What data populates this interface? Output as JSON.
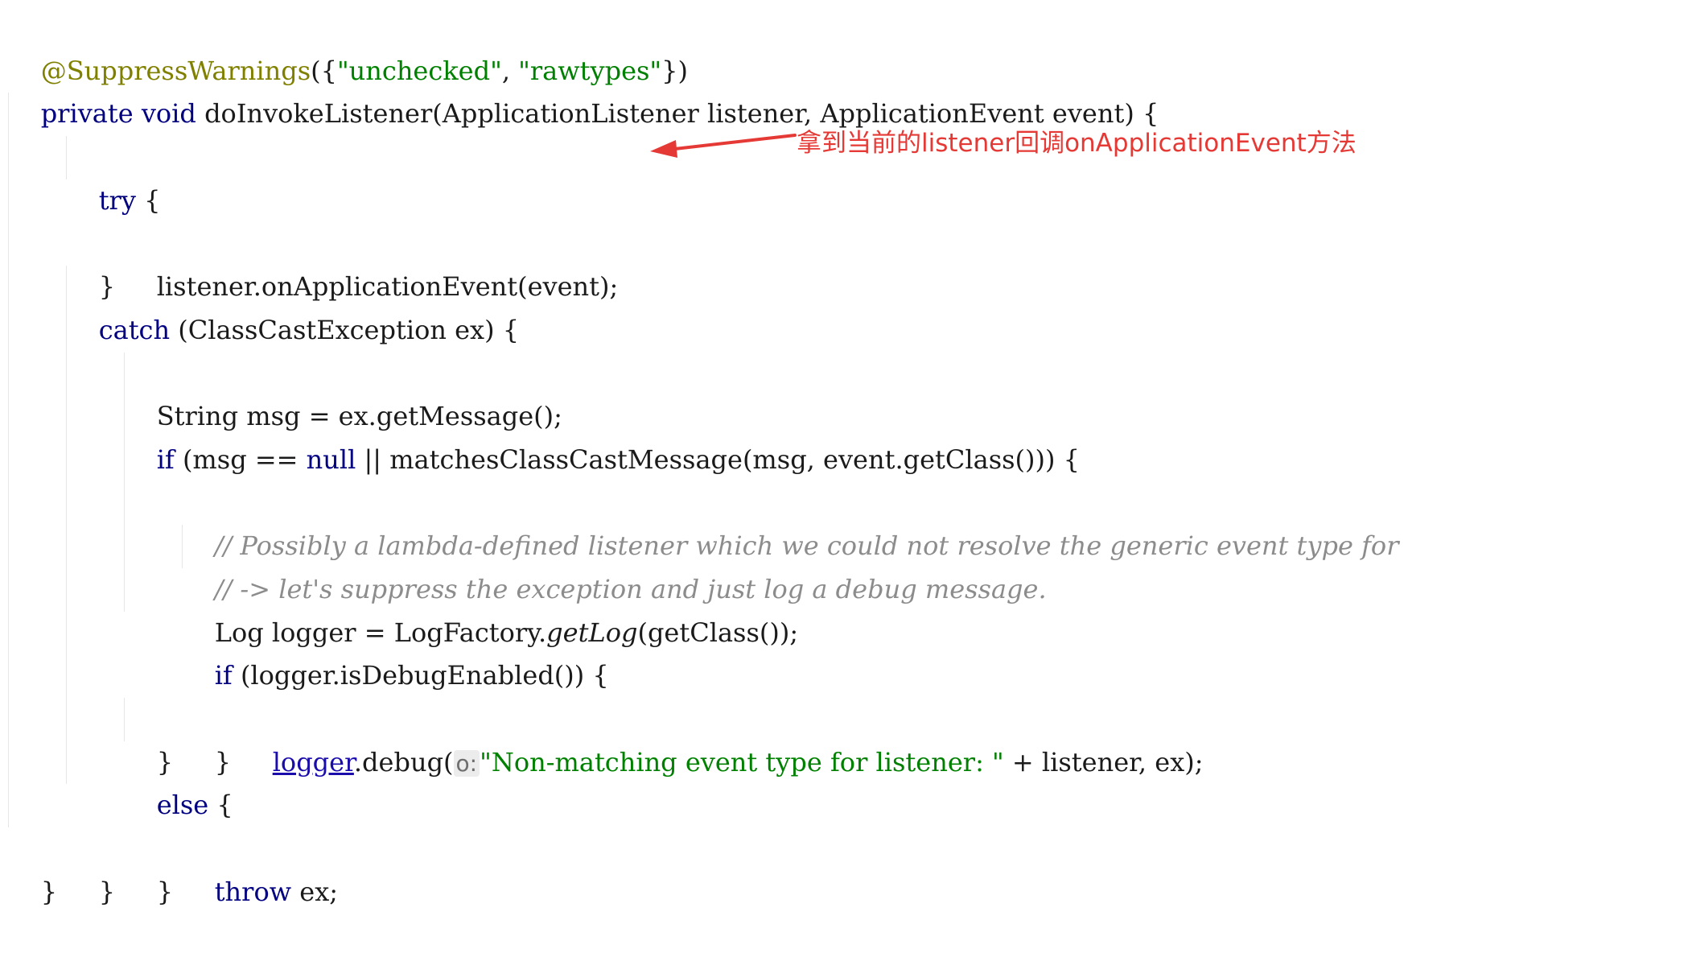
{
  "colors": {
    "annotation": "#808000",
    "keyword": "#000080",
    "string": "#008000",
    "comment": "#8c8c8c",
    "plain": "#1a1a1a",
    "field": "#1a0dab",
    "callout": "#e53935"
  },
  "code": {
    "l1": {
      "a": "@SuppressWarnings",
      "b": "({",
      "c": "\"unchecked\"",
      "d": ", ",
      "e": "\"rawtypes\"",
      "f": "})"
    },
    "l2": {
      "a": "private",
      "b": " ",
      "c": "void",
      "d": " doInvokeListener(ApplicationListener listener, ApplicationEvent event) {"
    },
    "l3": {
      "a": "try",
      "b": " {"
    },
    "l4": {
      "a": "listener.onApplicationEvent(event);"
    },
    "l5": {
      "a": "}"
    },
    "l6": {
      "a": "catch",
      "b": " (ClassCastException ex) {"
    },
    "l7": {
      "a": "String msg = ex.getMessage();"
    },
    "l8": {
      "a": "if",
      "b": " (msg == ",
      "c": "null",
      "d": " || matchesClassCastMessage(msg, event.getClass())) {"
    },
    "l9": {
      "a": "// Possibly a lambda-defined listener which we could not resolve the generic event type for"
    },
    "l10": {
      "a": "// -> let's suppress the exception and just log a debug message."
    },
    "l11": {
      "a": "Log logger = LogFactory.",
      "b": "getLog",
      "c": "(getClass());"
    },
    "l12": {
      "a": "if",
      "b": " (logger.isDebugEnabled()) {"
    },
    "l13": {
      "a": "logger",
      "b": ".debug(",
      "c": "o:",
      "d": "\"Non-matching event type for listener: \"",
      "e": " + listener, ex);"
    },
    "l14": {
      "a": "}"
    },
    "l15": {
      "a": "}"
    },
    "l16": {
      "a": "else",
      "b": " {"
    },
    "l17": {
      "a": "throw",
      "b": " ex;"
    },
    "l18": {
      "a": "}"
    },
    "l19": {
      "a": "}"
    },
    "l20": {
      "a": "}"
    }
  },
  "callout": {
    "text": "拿到当前的listener回调onApplicationEvent方法"
  }
}
